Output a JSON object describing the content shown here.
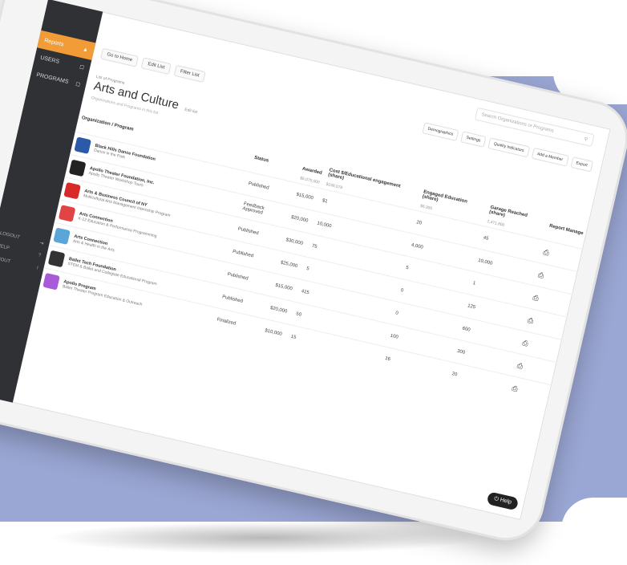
{
  "sidebar": {
    "items": [
      {
        "label": "Reports",
        "icon": "chart-icon"
      },
      {
        "label": "USERS",
        "icon": "users-icon"
      },
      {
        "label": "PROGRAMS",
        "icon": "programs-icon"
      }
    ],
    "lower_items": [
      {
        "label": "LOGOUT"
      },
      {
        "label": "HELP"
      },
      {
        "label": "ABOUT"
      }
    ]
  },
  "search": {
    "placeholder": "Search Organizations or Programs"
  },
  "toolbar": {
    "buttons": [
      "Go to Home",
      "Edit List",
      "Filter List"
    ]
  },
  "actions": [
    "Demographics",
    "Settings",
    "Quality Indicators",
    "Add a Member",
    "Export"
  ],
  "page": {
    "breadcrumb": "List of Programs",
    "title": "Arts and Culture",
    "edit_label": "Edit list",
    "subtitle": "Organizations and Programs in this list"
  },
  "table": {
    "headers": [
      "Organization / Program",
      "Status",
      "Awarded",
      "Cost $/Educational engagement (share)",
      "Engaged Education (share)",
      "Garage Reached (share)",
      "Report Manage"
    ],
    "subheaders": [
      "",
      "",
      "$6,075,000",
      "$198,078",
      "$6,000",
      "2,471,800",
      ""
    ],
    "rows": [
      {
        "org": "Black Hills Dance Foundation",
        "program": "Dance in the Park",
        "status": "Published",
        "awarded": "$15,000",
        "cost": "$1",
        "engaged": "20",
        "garage": "45",
        "logo_color": "#2a5aa8"
      },
      {
        "org": "Apollo Theater Foundation, Inc.",
        "program": "Apollo Theater Workshop Tours",
        "status": "Feedback Approved",
        "awarded": "$20,000",
        "cost": "10,000",
        "engaged": "4,000",
        "garage": "10,000",
        "logo_color": "#222222"
      },
      {
        "org": "Arts & Business Council of NY",
        "program": "Multicultural Arts Management Internship Program",
        "status": "Published",
        "awarded": "$30,000",
        "cost": "75",
        "engaged": "5",
        "garage": "1",
        "logo_color": "#d92a2a"
      },
      {
        "org": "Arts Connection",
        "program": "K-12 Education & Performance Programming",
        "status": "Published",
        "awarded": "$25,000",
        "cost": "5",
        "engaged": "0",
        "garage": "125",
        "logo_color": "#e04444"
      },
      {
        "org": "Arts Connection",
        "program": "Arts & Health in the Arts",
        "status": "Published",
        "awarded": "$15,000",
        "cost": "415",
        "engaged": "0",
        "garage": "600",
        "logo_color": "#5ba6d8"
      },
      {
        "org": "Ballet Tech Foundation",
        "program": "STEM & Ballet and Collegiate Educational Program",
        "status": "Published",
        "awarded": "$20,000",
        "cost": "50",
        "engaged": "100",
        "garage": "300",
        "logo_color": "#333333"
      },
      {
        "org": "Apollo Program",
        "program": "Ballet Theater Program Education & Outreach",
        "status": "Finalized",
        "awarded": "$10,000",
        "cost": "15",
        "engaged": "16",
        "garage": "20",
        "logo_color": "#a85ad8"
      }
    ]
  },
  "help": {
    "label": "Help"
  }
}
